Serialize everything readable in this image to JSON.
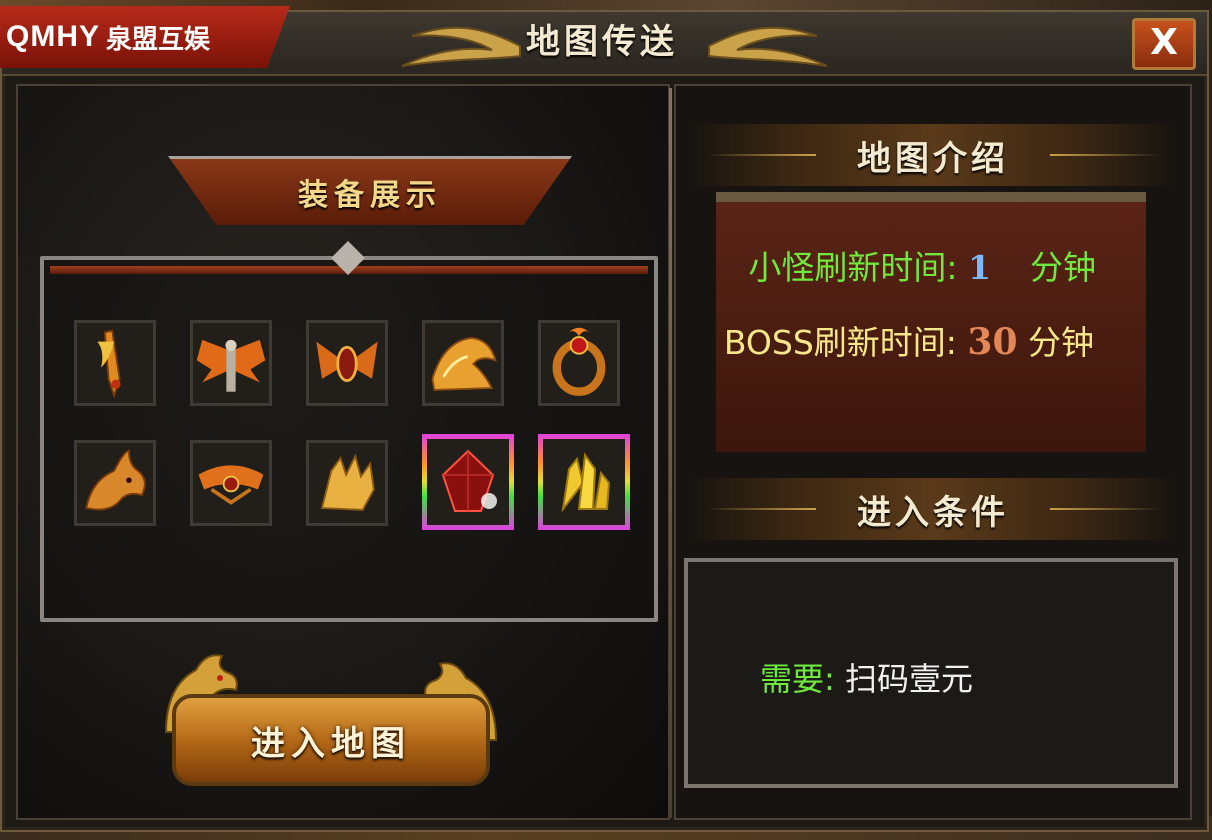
{
  "brand": {
    "logo_latin": "QMHY",
    "logo_cn": "泉盟互娱"
  },
  "window": {
    "title": "地图传送",
    "close_label": "X"
  },
  "equipment": {
    "header": "装备展示",
    "items": [
      {
        "icon": "flame-sword-icon"
      },
      {
        "icon": "fire-wings-armor-icon"
      },
      {
        "icon": "fire-wing-emblem-icon"
      },
      {
        "icon": "fire-dragon-helmet-icon"
      },
      {
        "icon": "fire-ring-icon"
      },
      {
        "icon": "dragon-head-icon"
      },
      {
        "icon": "fire-crown-icon"
      },
      {
        "icon": "golden-claw-icon"
      },
      {
        "icon": "red-gem-icon",
        "rare": true
      },
      {
        "icon": "gold-crystal-icon",
        "rare": true
      }
    ]
  },
  "enter_button": {
    "label": "进入地图"
  },
  "map_intro": {
    "header": "地图介绍",
    "monster_refresh": {
      "label": "小怪刷新时间:",
      "value": "1",
      "unit": "分钟"
    },
    "boss_refresh": {
      "label": "BOSS刷新时间:",
      "value": "30",
      "unit": "分钟"
    }
  },
  "entry_conditions": {
    "header": "进入条件",
    "requirement_label": "需要:",
    "requirement_value": "扫码壹元"
  },
  "colors": {
    "green_text": "#6ee93c",
    "yellow_text": "#f6e88a",
    "accent_gold": "#c9a24a",
    "panel_red": "#5a2416"
  }
}
